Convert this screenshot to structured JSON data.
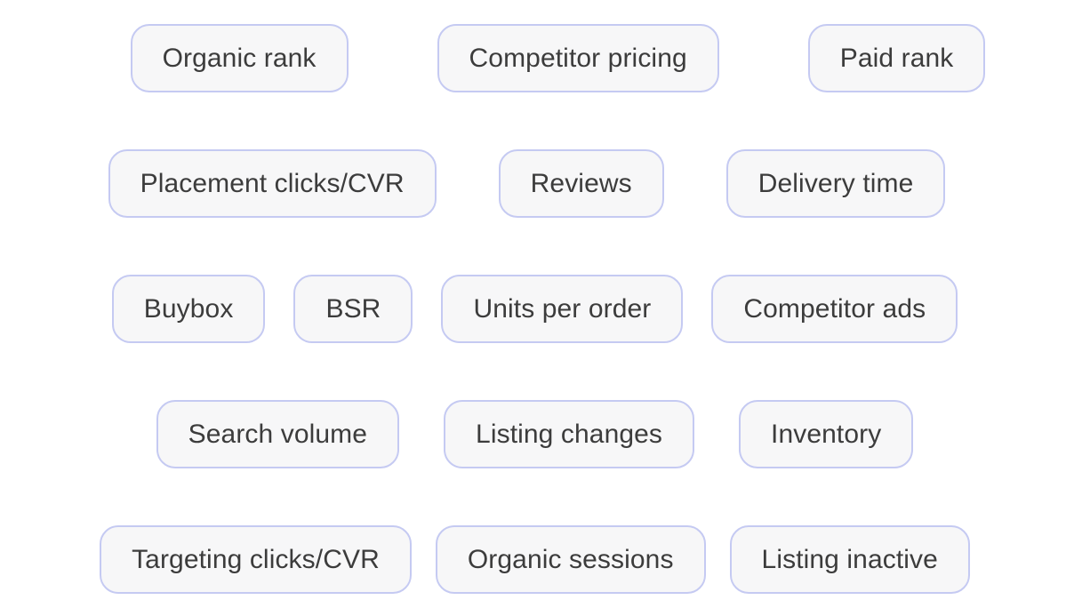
{
  "theme": {
    "background": "#ffffff",
    "pill_fill": "#f7f7f8",
    "pill_border": "#c5caf2",
    "pill_text": "#3c3c3c"
  },
  "tag_cloud": {
    "rows": [
      {
        "tags": [
          {
            "label": "Organic rank"
          },
          {
            "label": "Competitor pricing"
          },
          {
            "label": "Paid rank"
          }
        ]
      },
      {
        "tags": [
          {
            "label": "Placement clicks/CVR"
          },
          {
            "label": "Reviews"
          },
          {
            "label": "Delivery time"
          }
        ]
      },
      {
        "tags": [
          {
            "label": "Buybox"
          },
          {
            "label": "BSR"
          },
          {
            "label": "Units per order"
          },
          {
            "label": "Competitor ads"
          }
        ]
      },
      {
        "tags": [
          {
            "label": "Search volume"
          },
          {
            "label": "Listing changes"
          },
          {
            "label": "Inventory"
          }
        ]
      },
      {
        "tags": [
          {
            "label": "Targeting clicks/CVR"
          },
          {
            "label": "Organic sessions"
          },
          {
            "label": "Listing inactive"
          }
        ]
      }
    ]
  }
}
